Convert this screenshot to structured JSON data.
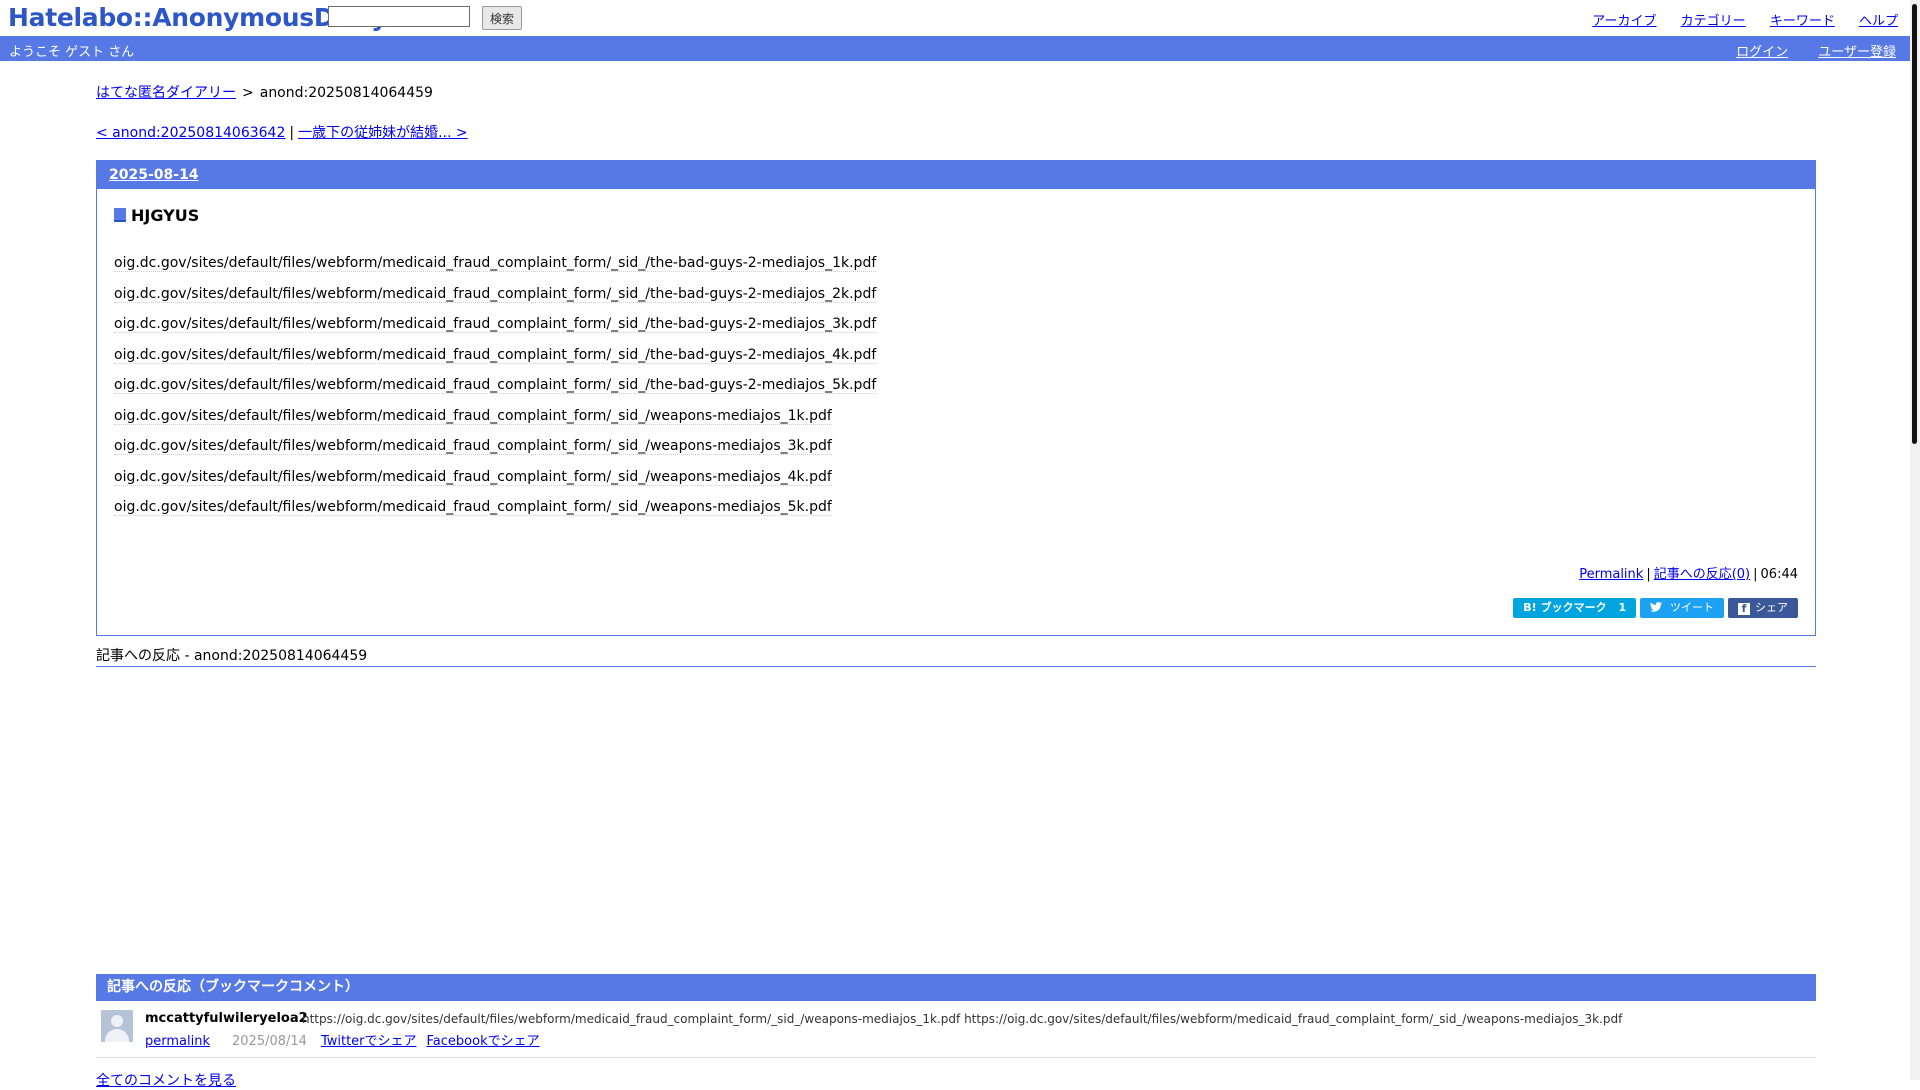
{
  "header": {
    "logo": "Hatelabo::AnonymousDiary",
    "search": {
      "value": "",
      "button_label": "検索"
    },
    "nav": [
      "アーカイブ",
      "カテゴリー",
      "キーワード",
      "ヘルプ"
    ]
  },
  "user_bar": {
    "welcome": "ようこそ ゲスト さん",
    "login": "ログイン",
    "register": "ユーザー登録"
  },
  "breadcrumb": {
    "home": "はてな匿名ダイアリー",
    "separator": ">",
    "current": "anond:20250814064459"
  },
  "pager": {
    "prev": "< anond:20250814063642",
    "separator": "|",
    "next": "一歳下の従姉妹が結婚... >"
  },
  "entry": {
    "date": "2025-08-14",
    "title": "HJGYUS",
    "lines": [
      "oig.dc.gov/sites/default/files/webform/medicaid_fraud_complaint_form/_sid_/the-bad-guys-2-mediajos_1k.pdf",
      "oig.dc.gov/sites/default/files/webform/medicaid_fraud_complaint_form/_sid_/the-bad-guys-2-mediajos_2k.pdf",
      "oig.dc.gov/sites/default/files/webform/medicaid_fraud_complaint_form/_sid_/the-bad-guys-2-mediajos_3k.pdf",
      "oig.dc.gov/sites/default/files/webform/medicaid_fraud_complaint_form/_sid_/the-bad-guys-2-mediajos_4k.pdf",
      "oig.dc.gov/sites/default/files/webform/medicaid_fraud_complaint_form/_sid_/the-bad-guys-2-mediajos_5k.pdf",
      "oig.dc.gov/sites/default/files/webform/medicaid_fraud_complaint_form/_sid_/weapons-mediajos_1k.pdf",
      "oig.dc.gov/sites/default/files/webform/medicaid_fraud_complaint_form/_sid_/weapons-mediajos_3k.pdf",
      "oig.dc.gov/sites/default/files/webform/medicaid_fraud_complaint_form/_sid_/weapons-mediajos_4k.pdf",
      "oig.dc.gov/sites/default/files/webform/medicaid_fraud_complaint_form/_sid_/weapons-mediajos_5k.pdf"
    ],
    "footer": {
      "permalink": "Permalink",
      "reactions": "記事への反応(0)",
      "separator": "|",
      "time": "06:44"
    },
    "share": {
      "bookmark_icon": "B!",
      "bookmark_label": "ブックマーク",
      "bookmark_count": "1",
      "tweet_label": "ツイート",
      "facebook_label": "シェア"
    }
  },
  "reactions_heading": "記事への反応 - anond:20250814064459",
  "bookmark_comments": {
    "heading": "記事への反応（ブックマークコメント）",
    "items": [
      {
        "user": "mccattyfulwileryeloa2",
        "text": "https://oig.dc.gov/sites/default/files/webform/medicaid_fraud_complaint_form/_sid_/weapons-mediajos_1k.pdf https://oig.dc.gov/sites/default/files/webform/medicaid_fraud_complaint_form/_sid_/weapons-mediajos_3k.pdf",
        "permalink": "permalink",
        "date": "2025/08/14",
        "twitter_share": "Twitterでシェア",
        "facebook_share": "Facebookでシェア"
      }
    ],
    "all_comments": "全てのコメントを見る"
  },
  "colors": {
    "accent": "#5779e6",
    "logo": "#2d56c7",
    "bookmark": "#00a4de",
    "twitter": "#1da1f2",
    "facebook": "#3b5998"
  }
}
